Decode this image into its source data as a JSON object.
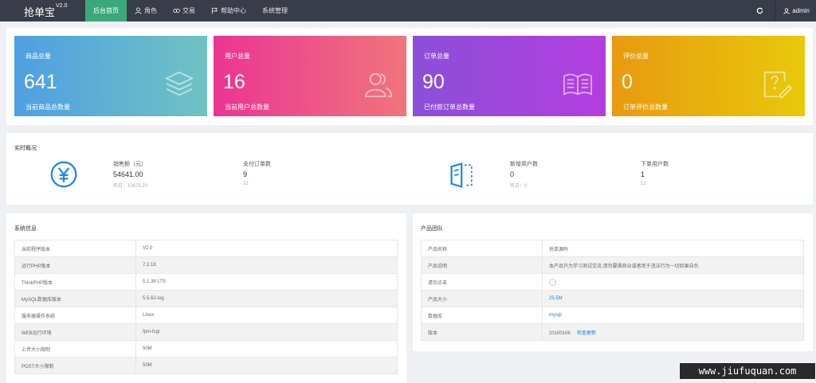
{
  "app": {
    "title": "抢单宝",
    "version": "V2.0"
  },
  "nav": [
    {
      "label": "后台首页",
      "icon": "",
      "active": true
    },
    {
      "label": "角色",
      "icon": "user-icon"
    },
    {
      "label": "交易",
      "icon": "exchange-icon"
    },
    {
      "label": "帮助中心",
      "icon": "flag-icon"
    },
    {
      "label": "系统管理",
      "icon": ""
    }
  ],
  "topbar": {
    "refresh_icon": "refresh-icon",
    "user": "admin"
  },
  "stats": [
    {
      "label": "商品总量",
      "value": "641",
      "sub": "当前商品总数量",
      "icon": "layers-icon"
    },
    {
      "label": "用户总量",
      "value": "16",
      "sub": "当前用户总数量",
      "icon": "users-icon"
    },
    {
      "label": "订单总量",
      "value": "90",
      "sub": "已付款订单总数量",
      "icon": "book-icon"
    },
    {
      "label": "评价总量",
      "value": "0",
      "sub": "订单评价总数量",
      "icon": "edit-icon"
    }
  ],
  "realtime": {
    "title": "实时概况",
    "sales": {
      "label": "销售额（元）",
      "value": "54641.00",
      "sub": "昨日：10679.20"
    },
    "orders": {
      "label": "支付订单数",
      "value": "9",
      "sub": "12"
    },
    "new_users": {
      "label": "新增用户数",
      "value": "0",
      "sub": "昨日：0"
    },
    "order_users": {
      "label": "下单用户数",
      "value": "1",
      "sub": "12"
    }
  },
  "sysinfo": {
    "title": "系统信息",
    "rows": [
      {
        "k": "当前程序版本",
        "v": "V2.0"
      },
      {
        "k": "运行PHP版本",
        "v": "7.2.18"
      },
      {
        "k": "ThinkPHP版本",
        "v": "5.1.38 LTS"
      },
      {
        "k": "MySQL数据库版本",
        "v": "5.5.62-log"
      },
      {
        "k": "服务器操作系统",
        "v": "Linux"
      },
      {
        "k": "WEB运行环境",
        "v": "fpm-fcgi"
      },
      {
        "k": "上传大小限制",
        "v": "50M"
      },
      {
        "k": "POST大小限制",
        "v": "50M"
      }
    ]
  },
  "team": {
    "title": "产品团队",
    "rows": [
      {
        "k": "产品名称",
        "v": "抢单源码"
      },
      {
        "k": "产品说明",
        "v": "本产品只为学习测试交流,请勿要做商业或者用于违法行为一切后果自负"
      },
      {
        "k": "请勿点击",
        "v": "···"
      },
      {
        "k": "产品大小",
        "v": "25.5M"
      },
      {
        "k": "数据库",
        "v": "mysql"
      },
      {
        "k": "版本",
        "v": "20100106",
        "link": "检查更新"
      }
    ]
  },
  "watermark": "www.jiufuquan.com",
  "colors": {
    "topbar": "#393d49",
    "active_nav": "#3ba87c",
    "accent_icon": "#1e88e5",
    "link": "#1e7fd8"
  }
}
